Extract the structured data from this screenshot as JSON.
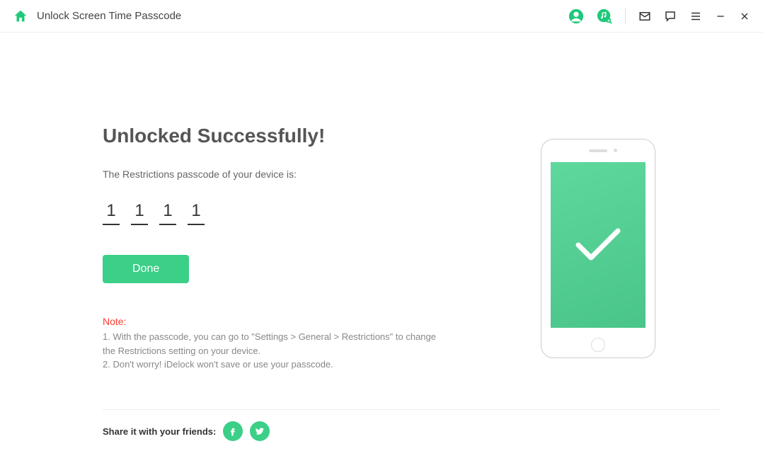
{
  "titlebar": {
    "title": "Unlock Screen Time Passcode"
  },
  "main": {
    "heading": "Unlocked Successfully!",
    "subtext": "The Restrictions passcode of your device is:",
    "passcode": [
      "1",
      "1",
      "1",
      "1"
    ],
    "done_label": "Done"
  },
  "notes": {
    "label": "Note:",
    "line1": "1. With the passcode, you can go to \"Settings > General > Restrictions\" to change the Restrictions setting on your device.",
    "line2": "2. Don't worry! iDelock won't save or use your passcode."
  },
  "footer": {
    "share_label": "Share it with your friends:"
  }
}
